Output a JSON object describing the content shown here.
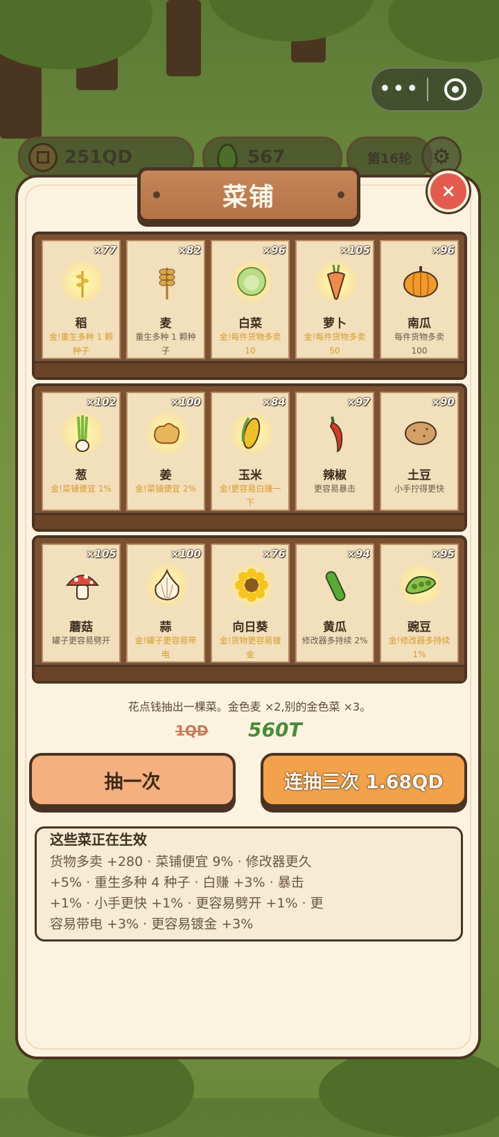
{
  "top_capsule": {
    "more_icon": "more-dots-icon",
    "target_icon": "target-icon"
  },
  "resources": {
    "coins": "251QD",
    "seeds": "567",
    "round": "第16轮"
  },
  "shop": {
    "title": "菜铺",
    "close_label": "×",
    "shelves": [
      [
        {
          "count": "×77",
          "name": "稻",
          "desc": "金!重生多种 1 颗种子",
          "gold": true,
          "icon": "rice-icon"
        },
        {
          "count": "×82",
          "name": "麦",
          "desc": "重生多种 1 颗种子",
          "gold": false,
          "icon": "wheat-icon"
        },
        {
          "count": "×96",
          "name": "白菜",
          "desc": "金!每件货物多卖 10",
          "gold": true,
          "icon": "cabbage-icon"
        },
        {
          "count": "×105",
          "name": "萝卜",
          "desc": "金!每件货物多卖 50",
          "gold": true,
          "icon": "carrot-icon"
        },
        {
          "count": "×96",
          "name": "南瓜",
          "desc": "每件货物多卖 100",
          "gold": false,
          "icon": "pumpkin-icon"
        }
      ],
      [
        {
          "count": "×102",
          "name": "葱",
          "desc": "金!菜铺便宜 1%",
          "gold": true,
          "icon": "scallion-icon"
        },
        {
          "count": "×100",
          "name": "姜",
          "desc": "金!菜铺便宜 2%",
          "gold": true,
          "icon": "ginger-icon"
        },
        {
          "count": "×84",
          "name": "玉米",
          "desc": "金!更容易白赚一下",
          "gold": true,
          "icon": "corn-icon"
        },
        {
          "count": "×97",
          "name": "辣椒",
          "desc": "更容易暴击",
          "gold": false,
          "icon": "chili-icon"
        },
        {
          "count": "×90",
          "name": "土豆",
          "desc": "小手拧得更快",
          "gold": false,
          "icon": "potato-icon"
        }
      ],
      [
        {
          "count": "×105",
          "name": "蘑菇",
          "desc": "罐子更容易劈开",
          "gold": false,
          "icon": "mushroom-icon"
        },
        {
          "count": "×100",
          "name": "蒜",
          "desc": "金!罐子更容易带电",
          "gold": true,
          "icon": "garlic-icon"
        },
        {
          "count": "×76",
          "name": "向日葵",
          "desc": "金!货物更容易镀金",
          "gold": true,
          "icon": "sunflower-icon"
        },
        {
          "count": "×94",
          "name": "黄瓜",
          "desc": "修改器多持续 2%",
          "gold": false,
          "icon": "cucumber-icon"
        },
        {
          "count": "×95",
          "name": "豌豆",
          "desc": "金!修改器多持续 1%",
          "gold": true,
          "icon": "pea-icon"
        }
      ]
    ],
    "hint": "花点钱抽出一棵菜。金色麦 ×2,别的金色菜 ×3。",
    "old_price": "1QD",
    "new_price": "560T",
    "draw_once": "抽一次",
    "draw_three": "连抽三次 1.68QD",
    "effects_title": "这些菜正在生效",
    "effects_body": "货物多卖 +280 · 菜铺便宜 9% · 修改器更久 +5% · 重生多种 4 种子 · 白赚 +3% · 暴击 +1% · 小手更快 +1% · 更容易劈开 +1% · 更容易带电 +3% · 更容易镀金 +3%"
  }
}
